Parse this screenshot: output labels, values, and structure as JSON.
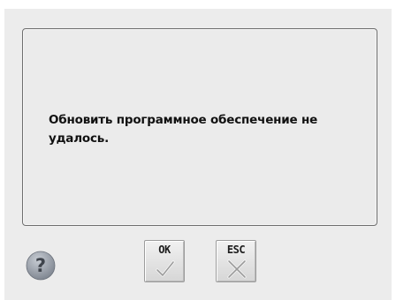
{
  "dialog": {
    "message": "Обновить программное обеспечение не удалось."
  },
  "buttons": {
    "ok_label": "OK",
    "esc_label": "ESC"
  },
  "icons": {
    "help": "question-mark-icon",
    "ok": "check-mark-icon",
    "esc": "cross-icon"
  }
}
